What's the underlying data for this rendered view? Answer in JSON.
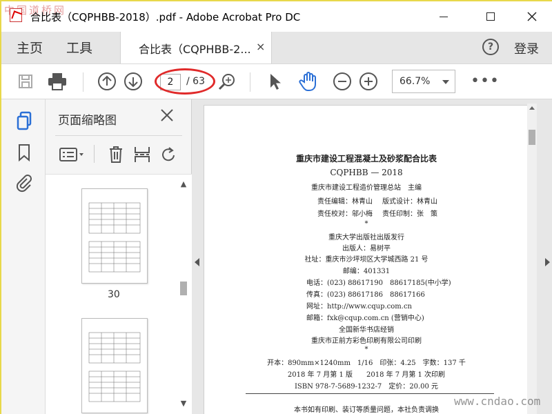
{
  "window": {
    "title": "合比表（CQPHBB-2018）.pdf - Adobe Acrobat Pro DC",
    "watermark_top": "中国道桥网"
  },
  "menu": {
    "home": "主页",
    "tools": "工具",
    "doc_tab": "合比表（CQPHBB-2...",
    "login": "登录"
  },
  "toolbar": {
    "current_page": "2",
    "total_pages": "/ 63",
    "zoom": "66.7%"
  },
  "panel": {
    "title": "页面缩略图",
    "thumbnails": [
      {
        "page_label": "30"
      }
    ]
  },
  "page_content": {
    "title": "重庆市建设工程混凝土及砂浆配合比表",
    "code": "CQPHBB — 2018",
    "editor": "重庆市建设工程造价管理总站　主编",
    "responsible_editor": "责任编辑：林青山",
    "layout_design": "版式设计：林青山",
    "proofreader": "责任校对：邬小梅",
    "printing": "责任印制：张　策",
    "star1": "*",
    "publisher": "重庆大学出版社出版发行",
    "publisher_person": "出版人：易树平",
    "address": "社址：重庆市沙坪坝区大学城西路 21 号",
    "postcode": "邮编：401331",
    "phone": "电话：(023) 88617190　88617185(中小学)",
    "fax": "传真：(023) 88617186　88617166",
    "website": "网址：http://www.cqup.com.cn",
    "email": "邮箱：fxk@cqup.com.cn (营销中心)",
    "distributor": "全国新华书店经销",
    "printer": "重庆市正前方彩色印刷有限公司印刷",
    "star2": "*",
    "format": "开本：890mm×1240mm　1/16　印张：4.25　字数：137 千",
    "edition": "2018 年 7 月第 1 版　　2018 年 7 月第 1 次印刷",
    "isbn": "ISBN 978-7-5689-1232-7　定价：20.00 元",
    "notice": "本书如有印刷、装订等质量问题，本社负责调换"
  },
  "watermark_bottom": "www.cndao.com",
  "colors": {
    "highlight_oval": "#e02a2a",
    "hand_tool": "#2a6fd6",
    "frame": "#e8d84a"
  }
}
